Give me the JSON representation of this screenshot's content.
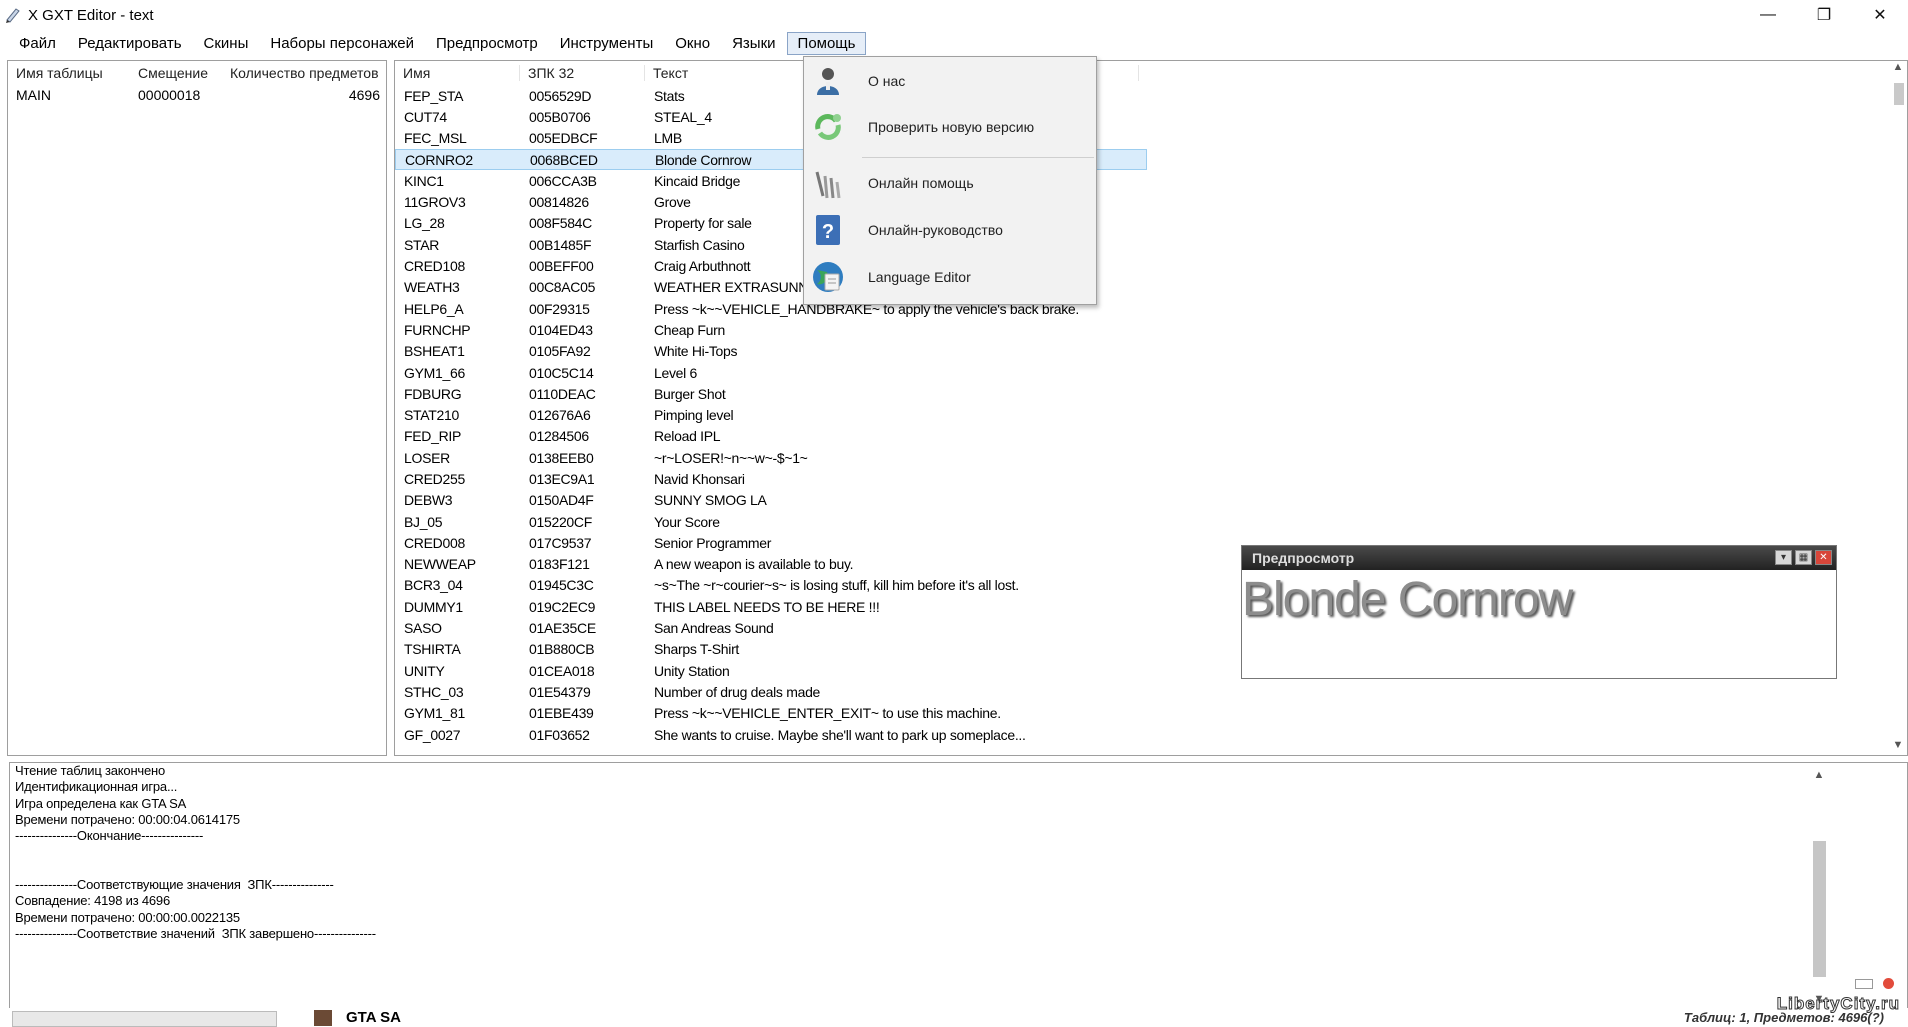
{
  "window": {
    "title": "X GXT Editor - text",
    "minimize": "—",
    "maximize": "❐",
    "close": "✕"
  },
  "menu": [
    "Файл",
    "Редактировать",
    "Скины",
    "Наборы персонажей",
    "Предпросмотр",
    "Инструменты",
    "Окно",
    "Языки",
    "Помощь"
  ],
  "tables": {
    "headers": [
      "Имя таблицы",
      "Смещение",
      "Количество предметов"
    ],
    "rows": [
      {
        "name": "MAIN",
        "offset": "00000018",
        "count": "4696"
      }
    ]
  },
  "entries": {
    "headers": [
      "Имя",
      "ЗПК 32",
      "Текст"
    ],
    "rows": [
      [
        "FEP_STA",
        "0056529D",
        "Stats"
      ],
      [
        "CUT74",
        "005B0706",
        "STEAL_4"
      ],
      [
        "FEC_MSL",
        "005EDBCF",
        "LMB"
      ],
      [
        "CORNRO2",
        "0068BCED",
        "Blonde Cornrow"
      ],
      [
        "KINC1",
        "006CCA3B",
        "Kincaid Bridge"
      ],
      [
        "11GROV3",
        "00814826",
        "Grove"
      ],
      [
        "LG_28",
        "008F584C",
        "Property for sale"
      ],
      [
        "STAR",
        "00B1485F",
        "Starfish Casino"
      ],
      [
        "CRED108",
        "00BEFF00",
        "Craig Arbuthnott"
      ],
      [
        "WEATH3",
        "00C8AC05",
        "WEATHER EXTRASUNN"
      ],
      [
        "HELP6_A",
        "00F29315",
        "Press ~k~~VEHICLE_HANDBRAKE~ to apply the vehicle's back brake."
      ],
      [
        "FURNCHP",
        "0104ED43",
        "Cheap Furn"
      ],
      [
        "BSHEAT1",
        "0105FA92",
        "White Hi-Tops"
      ],
      [
        "GYM1_66",
        "010C5C14",
        "Level 6"
      ],
      [
        "FDBURG",
        "0110DEAC",
        "Burger Shot"
      ],
      [
        "STAT210",
        "012676A6",
        "Pimping level"
      ],
      [
        "FED_RIP",
        "01284506",
        "Reload IPL"
      ],
      [
        "LOSER",
        "0138EEB0",
        "~r~LOSER!~n~~w~-$~1~"
      ],
      [
        "CRED255",
        "013EC9A1",
        "Navid Khonsari"
      ],
      [
        "DEBW3",
        "0150AD4F",
        "SUNNY SMOG LA"
      ],
      [
        "BJ_05",
        "015220CF",
        "Your Score"
      ],
      [
        "CRED008",
        "017C9537",
        "Senior Programmer"
      ],
      [
        "NEWWEAP",
        "0183F121",
        "A new weapon is available to buy."
      ],
      [
        "BCR3_04",
        "01945C3C",
        "~s~The ~r~courier~s~ is losing stuff, kill him before it's all lost."
      ],
      [
        "DUMMY1",
        "019C2EC9",
        "THIS LABEL NEEDS TO BE HERE !!!"
      ],
      [
        "SASO",
        "01AE35CE",
        "San Andreas Sound"
      ],
      [
        "TSHIRTA",
        "01B880CB",
        "Sharps T-Shirt"
      ],
      [
        "UNITY",
        "01CEA018",
        "Unity Station"
      ],
      [
        "STHC_03",
        "01E54379",
        "Number of drug deals made"
      ],
      [
        "GYM1_81",
        "01EBE439",
        "Press ~k~~VEHICLE_ENTER_EXIT~ to use this machine."
      ],
      [
        "GF_0027",
        "01F03652",
        "She wants to cruise. Maybe she'll want to park up someplace..."
      ]
    ],
    "selected_index": 3
  },
  "help_menu": [
    {
      "label": "О нас",
      "icon": "user-icon"
    },
    {
      "label": "Проверить новую версию",
      "icon": "update-icon"
    },
    {
      "label": "Онлайн помощь",
      "icon": "tools-icon"
    },
    {
      "label": "Онлайн-руководство",
      "icon": "help-book-icon"
    },
    {
      "label": "Language Editor",
      "icon": "globe-icon"
    }
  ],
  "preview": {
    "title": "Предпросмотр",
    "text": "Blonde Cornrow"
  },
  "log": [
    "Чтение таблиц закончено",
    "Идентификационная игра...",
    "Игра определена как GTA SA",
    "Времени потрачено: 00:00:04.0614175",
    "---------------Окончание---------------",
    "",
    "",
    "---------------Соответствующие значения  ЗПК---------------",
    "Совпадение: 4198 из 4696",
    "Времени потрачено: 00:00:00.0022135",
    "---------------Соответствие значений  ЗПК завершено---------------"
  ],
  "status": {
    "game": "GTA SA",
    "right": "Таблиц: 1, Предметов: 4696(?)",
    "watermark": "LibertyCity.ru"
  }
}
